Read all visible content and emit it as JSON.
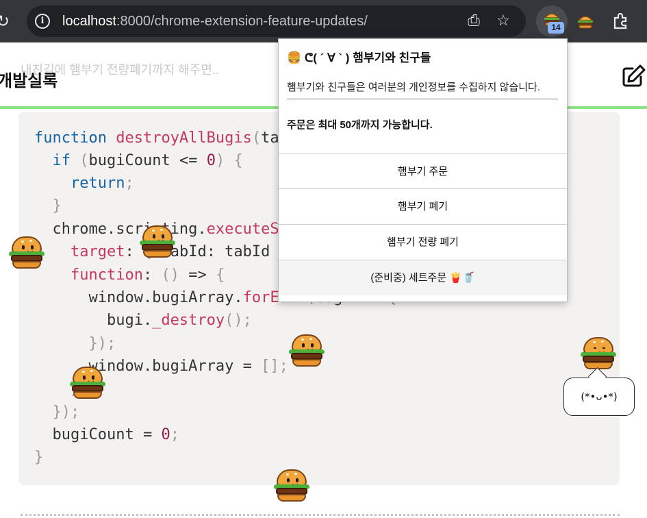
{
  "browser": {
    "url_host": "localhost",
    "url_rest": ":8000/chrome-extension-feature-updates/",
    "extension_badge": "14"
  },
  "page": {
    "site_title": "개발실록",
    "ghost_text": "내친김에 햄부기 전량폐기까지 해주면.."
  },
  "code": {
    "lines": [
      "function destroyAllBugis(ta",
      "  if (bugiCount <= 0) {",
      "    return;",
      "  }",
      "  chrome.scripting.executeS",
      "    target: { tabId: tabId",
      "    function: () => {",
      "      window.bugiArray.forEach(bugi => {",
      "        bugi._destroy();",
      "      });",
      "      window.bugiArray = [];",
      "    }",
      "  });",
      "  bugiCount = 0;",
      "}"
    ]
  },
  "popup": {
    "title": "🍔 ᕦ( ´ ∀ ` ) 햄부기와 친구들",
    "description": "햄부기와 친구들은 여러분의 개인정보를 수집하지 않습니다.",
    "limit_note": "주문은 최대 50개까지 가능합니다.",
    "buttons": [
      {
        "label": "햄부기 주문"
      },
      {
        "label": "햄부기 폐기"
      },
      {
        "label": "햄부기 전량 폐기"
      },
      {
        "label": "(준비중) 세트주문 🍟🥤",
        "disabled": true
      }
    ]
  },
  "speech_bubble": "(*•ᴗ•*)",
  "colors": {
    "toolbar_bg": "#35363a",
    "accent_green": "#90e28a",
    "code_bg": "#f3f2f1",
    "keyword": "#1565a6",
    "function_name": "#c4395c",
    "badge": "#8ab4f8"
  },
  "icons": [
    "reload-icon",
    "site-info-icon",
    "install-app-icon",
    "bookmark-star-icon",
    "burger-extension-icon",
    "puzzle-extensions-icon",
    "edit-icon"
  ]
}
